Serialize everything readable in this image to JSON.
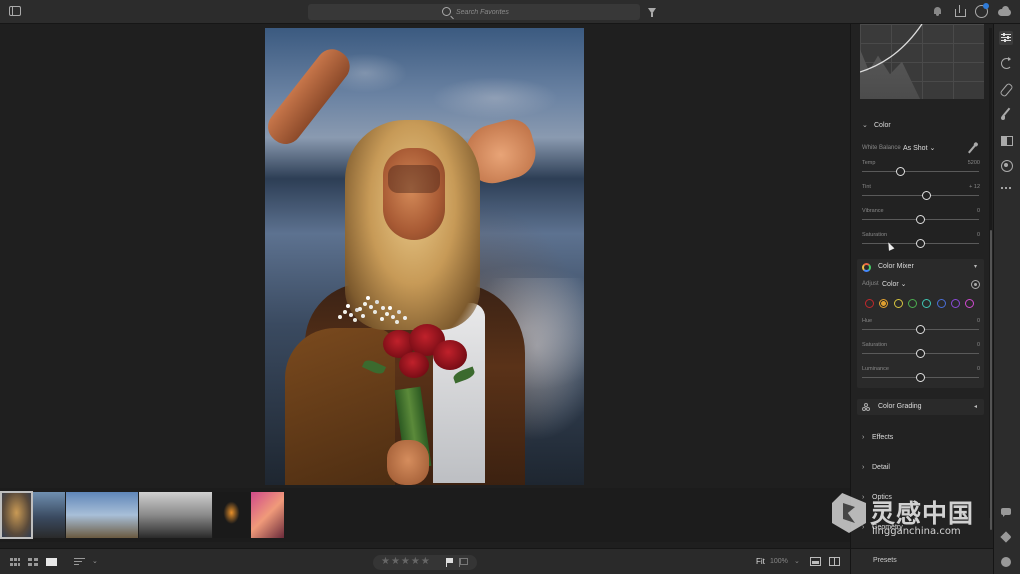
{
  "search": {
    "placeholder": "Search Favorites"
  },
  "panel": {
    "color_section": {
      "title": "Color"
    },
    "white_balance": {
      "label": "White Balance",
      "value": "As Shot"
    },
    "sliders": [
      {
        "label": "Temp",
        "value": "5200",
        "level": 0.33
      },
      {
        "label": "Tint",
        "value": "+ 12",
        "level": 0.55
      },
      {
        "label": "Vibrance",
        "value": "0",
        "level": 0.5
      },
      {
        "label": "Saturation",
        "value": "0",
        "level": 0.5
      }
    ],
    "color_mixer": {
      "title": "Color Mixer",
      "adjust_label": "Adjust",
      "adjust_value": "Color",
      "swatch_colors": [
        "#c0282c",
        "#e0a030",
        "#d8c640",
        "#4caf50",
        "#3fc7b3",
        "#4a6fd8",
        "#8a4ad8",
        "#d04ad0"
      ],
      "selected_swatch": 1,
      "sliders": [
        {
          "label": "Hue",
          "value": "0",
          "level": 0.5
        },
        {
          "label": "Saturation",
          "value": "0",
          "level": 0.5
        },
        {
          "label": "Luminance",
          "value": "0",
          "level": 0.5
        }
      ]
    },
    "color_grading": {
      "title": "Color Grading"
    },
    "effects": {
      "title": "Effects"
    },
    "detail": {
      "title": "Detail"
    },
    "optics": {
      "title": "Optics"
    },
    "geometry": {
      "title": "Geometry"
    },
    "presets": "Presets"
  },
  "bottom": {
    "stars": "★★★★★",
    "fit": "Fit",
    "zoom": "100%"
  },
  "watermark": {
    "cn": "灵感中国",
    "en": "lingganchina.com"
  },
  "colors": {
    "accent": "#2f7bd8",
    "background": "#1f1f1f",
    "panel": "#222222"
  }
}
